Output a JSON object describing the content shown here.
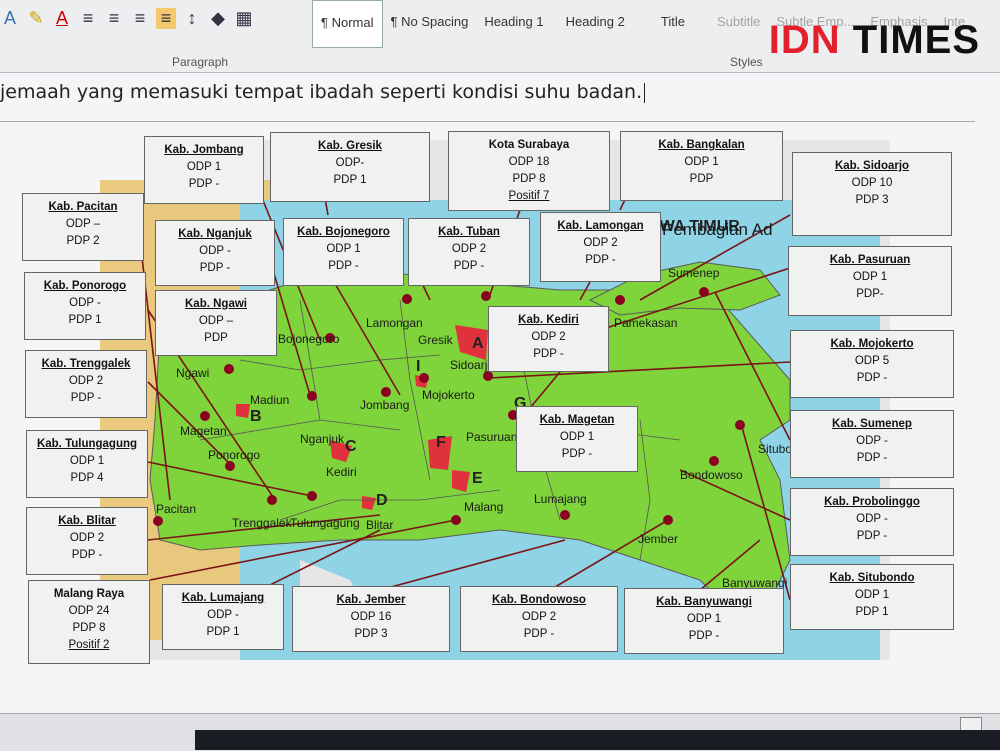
{
  "ribbon": {
    "paragraph_label": "Paragraph",
    "styles_label": "Styles",
    "styles": [
      "¶ Normal",
      "¶ No Spacing",
      "Heading 1",
      "Heading 2",
      "Title",
      "Subtitle",
      "Subtle Emp...",
      "Emphasis",
      "Inte"
    ]
  },
  "logo": {
    "part1": "IDN",
    "part2": " TIMES"
  },
  "document": {
    "line": "jemaah yang memasuki tempat ibadah seperti kondisi suhu badan."
  },
  "map": {
    "title": "JAWA TIMUR",
    "subtitle": "Pembagian Ad",
    "labels": [
      "Lamongan",
      "Gresik",
      "Sidoarjo",
      "Bojonegoro",
      "Ngawi",
      "Madiun",
      "Nganjuk",
      "Jombang",
      "Mojokerto",
      "Magetan",
      "Ponorogo",
      "Kediri",
      "Pasuruan",
      "Malang",
      "Lumajang",
      "Bondowoso",
      "Jember",
      "Pacitan",
      "Trenggalek",
      "Tulungagung",
      "Blitar",
      "Banyuwangi",
      "Sumenep",
      "Pamekasan",
      "Situbondo"
    ],
    "markers": [
      "A",
      "B",
      "C",
      "D",
      "E",
      "F",
      "G",
      "I"
    ]
  },
  "boxes": [
    {
      "title": "Kab. Jombang",
      "l1": "ODP 1",
      "l2": "PDP -"
    },
    {
      "title": "Kab. Gresik",
      "l1": "ODP-",
      "l2": "PDP 1"
    },
    {
      "title": "Kota Surabaya",
      "l1": "ODP 18",
      "l2": "PDP 8",
      "l3": "Positif 7"
    },
    {
      "title": "Kab. Bangkalan",
      "l1": "ODP 1",
      "l2": "PDP"
    },
    {
      "title": "Kab. Sidoarjo",
      "l1": "ODP 10",
      "l2": "PDP 3"
    },
    {
      "title": "Kab. Pacitan",
      "l1": "ODP –",
      "l2": "PDP 2"
    },
    {
      "title": "Kab. Nganjuk",
      "l1": "ODP  -",
      "l2": "PDP -"
    },
    {
      "title": "Kab. Bojonegoro",
      "l1": "ODP 1",
      "l2": "PDP -"
    },
    {
      "title": "Kab. Tuban",
      "l1": "ODP  2",
      "l2": "PDP -"
    },
    {
      "title": "Kab. Lamongan",
      "l1": "ODP 2",
      "l2": "PDP -"
    },
    {
      "title": "Kab. Pasuruan",
      "l1": "ODP 1",
      "l2": "PDP-"
    },
    {
      "title": "Kab. Ponorogo",
      "l1": "ODP -",
      "l2": "PDP 1"
    },
    {
      "title": "Kab. Ngawi",
      "l1": "ODP –",
      "l2": "PDP"
    },
    {
      "title": "Kab. Kediri",
      "l1": "ODP 2",
      "l2": "PDP -"
    },
    {
      "title": "Kab. Mojokerto",
      "l1": "ODP 5",
      "l2": "PDP -"
    },
    {
      "title": "Kab. Trenggalek",
      "l1": "ODP 2",
      "l2": "PDP -"
    },
    {
      "title": "Kab. Magetan",
      "l1": "ODP 1",
      "l2": "PDP -"
    },
    {
      "title": "Kab. Sumenep",
      "l1": "ODP -",
      "l2": "PDP -"
    },
    {
      "title": "Kab. Tulungagung",
      "l1": "ODP 1",
      "l2": "PDP 4"
    },
    {
      "title": "Kab. Probolinggo",
      "l1": "ODP -",
      "l2": "PDP -"
    },
    {
      "title": "Kab. Blitar",
      "l1": "ODP 2",
      "l2": "PDP -"
    },
    {
      "title": "Kab. Situbondo",
      "l1": "ODP  1",
      "l2": "PDP 1"
    },
    {
      "title": "Malang Raya",
      "l1": "ODP 24",
      "l2": "PDP 8",
      "l3": "Positif 2"
    },
    {
      "title": "Kab. Lumajang",
      "l1": "ODP -",
      "l2": "PDP 1"
    },
    {
      "title": "Kab. Jember",
      "l1": "ODP 16",
      "l2": "PDP 3"
    },
    {
      "title": "Kab. Bondowoso",
      "l1": "ODP 2",
      "l2": "PDP -"
    },
    {
      "title": "Kab. Banyuwangi",
      "l1": "ODP 1",
      "l2": "PDP -"
    }
  ]
}
